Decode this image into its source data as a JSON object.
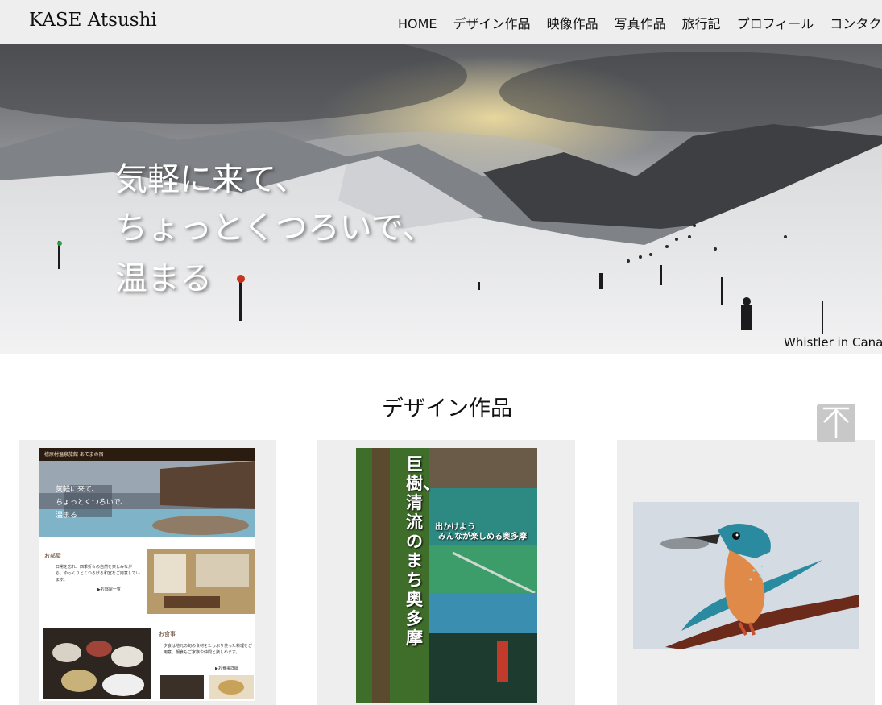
{
  "header": {
    "logo": "KASE Atsushi",
    "nav": [
      "HOME",
      "デザイン作品",
      "映像作品",
      "写真作品",
      "旅行記",
      "プロフィール",
      "コンタクト"
    ]
  },
  "hero": {
    "lines": [
      "気軽に来て、",
      "ちょっとくつろいで、",
      "温まる"
    ],
    "caption": "Whistler in Canada"
  },
  "section": {
    "title": "デザイン作品"
  },
  "cards": {
    "web": {
      "brand": "檜原村温泉旅館 あてまの宿",
      "hero_lines": [
        "気軽に来て、",
        "ちょっとくつろいで、",
        "温まる"
      ],
      "room_heading": "お部屋",
      "room_text": "日常を忘れ、四季折々の自然を楽しみながら、ゆっくりとくつろげる和室をご用意しています。",
      "room_link": "▶お部屋一覧",
      "meal_heading": "お食事",
      "meal_text": "夕食は地元の旬の食材をたっぷり使った料理をご用意。朝食もご家族や仲間と楽しめます。",
      "meal_link": "▶お食事詳細"
    },
    "poster": {
      "title": "巨樹、清流のまち 奥多摩",
      "subtitle_1": "出かけよう",
      "subtitle_2": "みんなが楽しめる奥多摩"
    }
  },
  "colors": {
    "header_bg": "#eeeeee",
    "card_bg": "#eeeeee",
    "scroll_button": "#c8c8c8"
  },
  "icons": {
    "scroll_top": "arrow-up-icon"
  }
}
